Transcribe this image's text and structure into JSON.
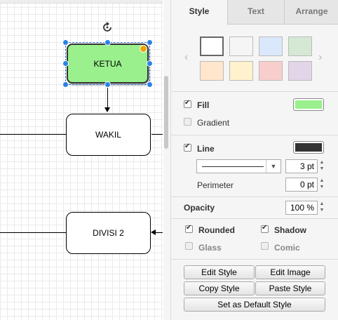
{
  "diagram": {
    "nodes": {
      "ketua": "KETUA",
      "wakil": "WAKIL",
      "divisi2": "DIVISI 2"
    }
  },
  "panel": {
    "tabs": {
      "style": "Style",
      "text": "Text",
      "arrange": "Arrange"
    },
    "swatch_colors": [
      "#ffffff",
      "#f5f5f5",
      "#dae8fc",
      "#d5e8d4",
      "#ffe6cc",
      "#fff2cc",
      "#f8cecc",
      "#e1d5e7"
    ],
    "fill": {
      "label": "Fill",
      "checked": true,
      "color": "#99f08c"
    },
    "gradient": {
      "label": "Gradient",
      "checked": false
    },
    "line": {
      "label": "Line",
      "checked": true,
      "color": "#333333",
      "width": "3 pt"
    },
    "perimeter": {
      "label": "Perimeter",
      "value": "0 pt"
    },
    "opacity": {
      "label": "Opacity",
      "value": "100 %"
    },
    "rounded": {
      "label": "Rounded",
      "checked": true
    },
    "shadow": {
      "label": "Shadow",
      "checked": true
    },
    "glass": {
      "label": "Glass",
      "checked": false
    },
    "comic": {
      "label": "Comic",
      "checked": false
    },
    "buttons": {
      "edit_style": "Edit Style",
      "edit_image": "Edit Image",
      "copy_style": "Copy Style",
      "paste_style": "Paste Style",
      "set_default": "Set as Default Style"
    }
  }
}
